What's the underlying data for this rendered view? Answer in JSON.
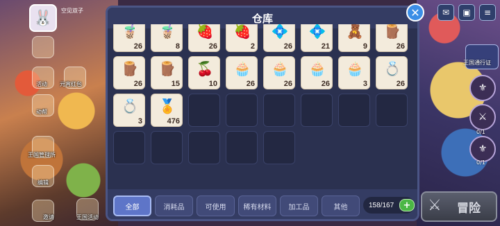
{
  "hud": {
    "player_name": "空见双子",
    "left_labels": [
      "元宵红包",
      "活动",
      "动帮",
      "王国管理所",
      "编辑",
      "邀请",
      "王国活动"
    ],
    "pass_label": "王国通行证",
    "right_counts": [
      "0/1",
      "0/1"
    ],
    "adventure_label": "冒险"
  },
  "panel": {
    "title": "仓库",
    "close_icon": "close-icon"
  },
  "inventory": {
    "items": [
      {
        "icon": "boba-tea-icon",
        "glyph": "🧋",
        "count": "26"
      },
      {
        "icon": "boba-tea-icon",
        "glyph": "🧋",
        "count": "8"
      },
      {
        "icon": "strawberry-jar-icon",
        "glyph": "🍓",
        "count": "26"
      },
      {
        "icon": "strawberry-jar-icon",
        "glyph": "🍓",
        "count": "2"
      },
      {
        "icon": "blue-crystal-icon",
        "glyph": "💠",
        "count": "26"
      },
      {
        "icon": "blue-crystal-icon",
        "glyph": "💠",
        "count": "21"
      },
      {
        "icon": "pink-bear-icon",
        "glyph": "🧸",
        "count": "9"
      },
      {
        "icon": "wood-log-icon",
        "glyph": "🪵",
        "count": "26"
      },
      {
        "icon": "wood-log-icon",
        "glyph": "🪵",
        "count": "26"
      },
      {
        "icon": "wood-log-icon",
        "glyph": "🪵",
        "count": "15"
      },
      {
        "icon": "berry-jam-icon",
        "glyph": "🍒",
        "count": "10"
      },
      {
        "icon": "cupcake-icon",
        "glyph": "🧁",
        "count": "26"
      },
      {
        "icon": "cupcake-icon",
        "glyph": "🧁",
        "count": "26"
      },
      {
        "icon": "cupcake-icon",
        "glyph": "🧁",
        "count": "26"
      },
      {
        "icon": "cupcake-icon",
        "glyph": "🧁",
        "count": "3"
      },
      {
        "icon": "diamond-ring-icon",
        "glyph": "💍",
        "count": "26"
      },
      {
        "icon": "diamond-ring-icon",
        "glyph": "💍",
        "count": "3"
      },
      {
        "icon": "gold-cookie-icon",
        "glyph": "🏅",
        "count": "476"
      }
    ],
    "empty_slots": 11
  },
  "tabs": [
    {
      "label": "全部",
      "active": true
    },
    {
      "label": "消耗品",
      "active": false
    },
    {
      "label": "可使用",
      "active": false
    },
    {
      "label": "稀有材料",
      "active": false
    },
    {
      "label": "加工品",
      "active": false
    },
    {
      "label": "其他",
      "active": false
    }
  ],
  "capacity": {
    "text": "158/167",
    "plus_icon": "plus-icon"
  },
  "colors": {
    "panel_bg": "#2b3150",
    "accent_blue": "#5e75c8",
    "plus_green": "#4bb745",
    "close_blue": "#3b8ee6"
  }
}
